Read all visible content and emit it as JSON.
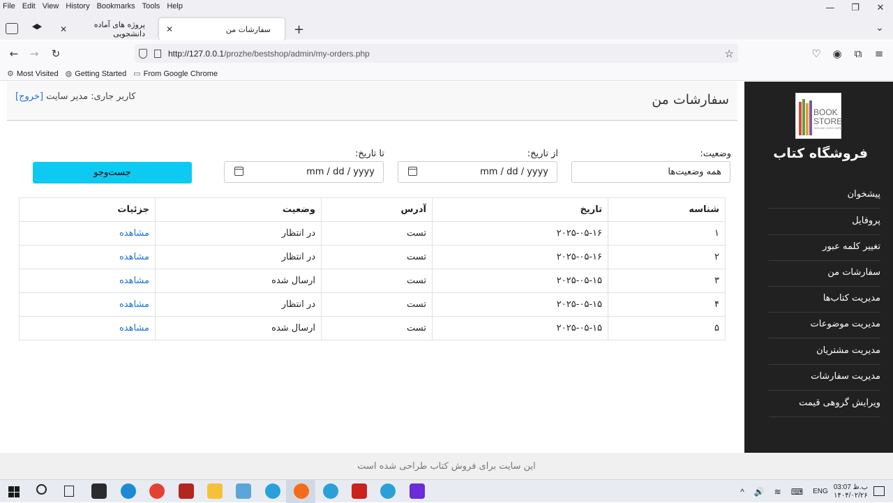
{
  "browser": {
    "menu": [
      "File",
      "Edit",
      "View",
      "History",
      "Bookmarks",
      "Tools",
      "Help"
    ],
    "tabs": [
      {
        "title": "پروژه های آماده دانشجویی",
        "active": false
      },
      {
        "title": "سفارشات من",
        "active": true
      }
    ],
    "url_scheme_host": "http://127.0.0.1",
    "url_path": "/prozhe/bestshop/admin/my-orders.php",
    "bookmarks": [
      "Most Visited",
      "Getting Started",
      "From Google Chrome"
    ]
  },
  "sidebar": {
    "logo_line1": "BOOK",
    "logo_line2": "STORE",
    "logo_tagline": "TAGLINE GOES HERE",
    "brand": "فروشگاه کتاب",
    "items": [
      "پیشخوان",
      "پروفایل",
      "تغییر کلمه عبور",
      "سفارشات من",
      "مدیریت کتاب‌ها",
      "مدیریت موضوعات",
      "مدیریت مشتریان",
      "مدیریت سفارشات",
      "ویرایش گروهی قیمت"
    ]
  },
  "header": {
    "title": "سفارشات من",
    "user_prefix": "کاربر جاری: مدیر سایت",
    "logout": "[خروج]"
  },
  "filters": {
    "status_label": "وضعیت:",
    "status_value": "همه وضعیت‌ها",
    "from_label": "از تاریخ:",
    "from_value": "mm / dd / yyyy",
    "to_label": "تا تاریخ:",
    "to_value": "mm / dd / yyyy",
    "search_button": "جست‌وجو"
  },
  "table": {
    "headers": [
      "شناسه",
      "تاریخ",
      "آدرس",
      "وضعیت",
      "جزئیات"
    ],
    "rows": [
      [
        "۱",
        "۲۰۲۵-۰۵-۱۶",
        "تست",
        "در انتظار",
        "مشاهده"
      ],
      [
        "۲",
        "۲۰۲۵-۰۵-۱۶",
        "تست",
        "در انتظار",
        "مشاهده"
      ],
      [
        "۳",
        "۲۰۲۵-۰۵-۱۵",
        "تست",
        "ارسال شده",
        "مشاهده"
      ],
      [
        "۴",
        "۲۰۲۵-۰۵-۱۵",
        "تست",
        "در انتظار",
        "مشاهده"
      ],
      [
        "۵",
        "۲۰۲۵-۰۵-۱۵",
        "تست",
        "ارسال شده",
        "مشاهده"
      ]
    ]
  },
  "footer": "این سایت برای فروش کتاب طراحی شده است",
  "taskbar": {
    "lang": "ENG",
    "time": "03:07 ب.ظ",
    "date": "۱۴۰۴/۰۲/۲۶"
  },
  "colors": {
    "sidebar": "#212121",
    "search_button": "#0dcaf0",
    "link": "#1e6fd9"
  }
}
